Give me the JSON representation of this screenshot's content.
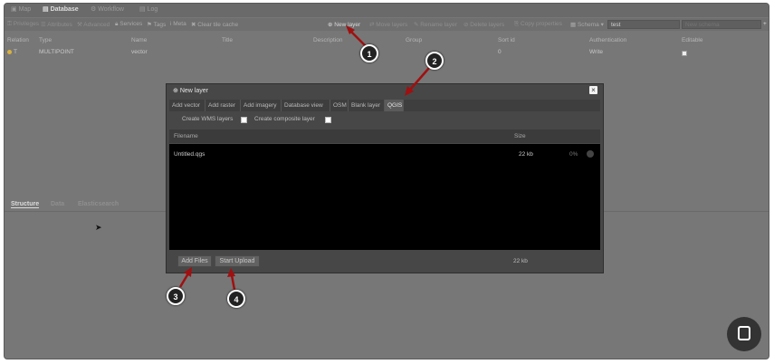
{
  "top_tabs": [
    "Map",
    "Database",
    "Workflow",
    "Log"
  ],
  "toolbar": {
    "privileges": "Privileges",
    "attributes": "Attributes",
    "advanced": "Advanced",
    "services": "Services",
    "tags": "Tags",
    "meta": "Meta",
    "clear_tile_cache": "Clear tile cache",
    "new_layer": "New layer",
    "move_layers": "Move layers",
    "rename_layer": "Rename layer",
    "delete_layers": "Delete layers",
    "copy_properties": "Copy properties",
    "schema_label": "Schema",
    "schema_value": "test",
    "new_schema_placeholder": "New schema"
  },
  "table": {
    "headers": [
      "Relation",
      "Type",
      "Name",
      "Title",
      "Description",
      "Group",
      "Sort id",
      "Authentication",
      "Editable"
    ],
    "row": {
      "relation": "T",
      "type": "MULTIPOINT",
      "name": "vector",
      "sort_id": "0",
      "authentication": "Write"
    }
  },
  "lower_tabs": [
    "Structure",
    "Data",
    "Elasticsearch"
  ],
  "modal": {
    "title": "New layer",
    "tabs": [
      "Add vector",
      "Add raster",
      "Add imagery",
      "Database view",
      "OSM",
      "Blank layer",
      "QGIS"
    ],
    "active_tab": "QGIS",
    "create_wms": "Create WMS layers",
    "create_composite": "Create composite layer",
    "file_headers": {
      "filename": "Filename",
      "size": "Size"
    },
    "file": {
      "name": "Untitled.qgs",
      "size": "22 kb",
      "progress": "0%"
    },
    "add_files": "Add Files",
    "start_upload": "Start Upload",
    "total_size": "22 kb"
  },
  "callouts": [
    "1",
    "2",
    "3",
    "4"
  ],
  "colors": {
    "callout": "#222222",
    "arrow": "#a01010",
    "active_tab": "#5b5b5b"
  }
}
